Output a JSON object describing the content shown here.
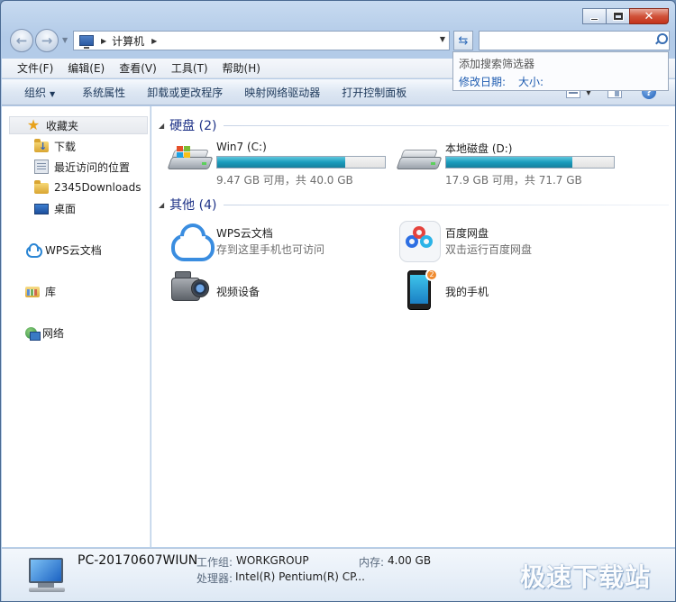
{
  "address": {
    "crumbs": [
      "计算机"
    ]
  },
  "search": {
    "placeholder": "",
    "value": "",
    "popup_hint": "添加搜索筛选器",
    "filters": [
      "修改日期:",
      "大小:"
    ]
  },
  "menu": [
    "文件(F)",
    "编辑(E)",
    "查看(V)",
    "工具(T)",
    "帮助(H)"
  ],
  "commands": [
    "组织",
    "系统属性",
    "卸载或更改程序",
    "映射网络驱动器",
    "打开控制面板"
  ],
  "nav": {
    "favorites": {
      "label": "收藏夹",
      "items": [
        "下载",
        "最近访问的位置",
        "2345Downloads",
        "桌面"
      ]
    },
    "wps": "WPS云文档",
    "library": "库",
    "network": "网络"
  },
  "groups": {
    "drives": {
      "title": "硬盘 (2)"
    },
    "other": {
      "title": "其他 (4)"
    }
  },
  "drives": [
    {
      "name": "Win7 (C:)",
      "info": "9.47 GB 可用，共 40.0 GB",
      "used_fraction": 0.763
    },
    {
      "name": "本地磁盘 (D:)",
      "info": "17.9 GB 可用，共 71.7 GB",
      "used_fraction": 0.75
    }
  ],
  "others": [
    {
      "name": "WPS云文档",
      "sub": "存到这里手机也可访问"
    },
    {
      "name": "百度网盘",
      "sub": "双击运行百度网盘"
    },
    {
      "name": "视频设备",
      "sub": ""
    },
    {
      "name": "我的手机",
      "sub": ""
    }
  ],
  "details": {
    "pc_name": "PC-20170607WIUN",
    "workgroup_label": "工作组:",
    "workgroup": "WORKGROUP",
    "memory_label": "内存:",
    "memory": "4.00 GB",
    "cpu_label": "处理器:",
    "cpu": "Intel(R) Pentium(R) CP..."
  },
  "watermark": "极速下载站",
  "colors": {
    "accent": "#1e3287",
    "bar_fill": "#1a9cbd",
    "link": "#1d5bb0"
  }
}
